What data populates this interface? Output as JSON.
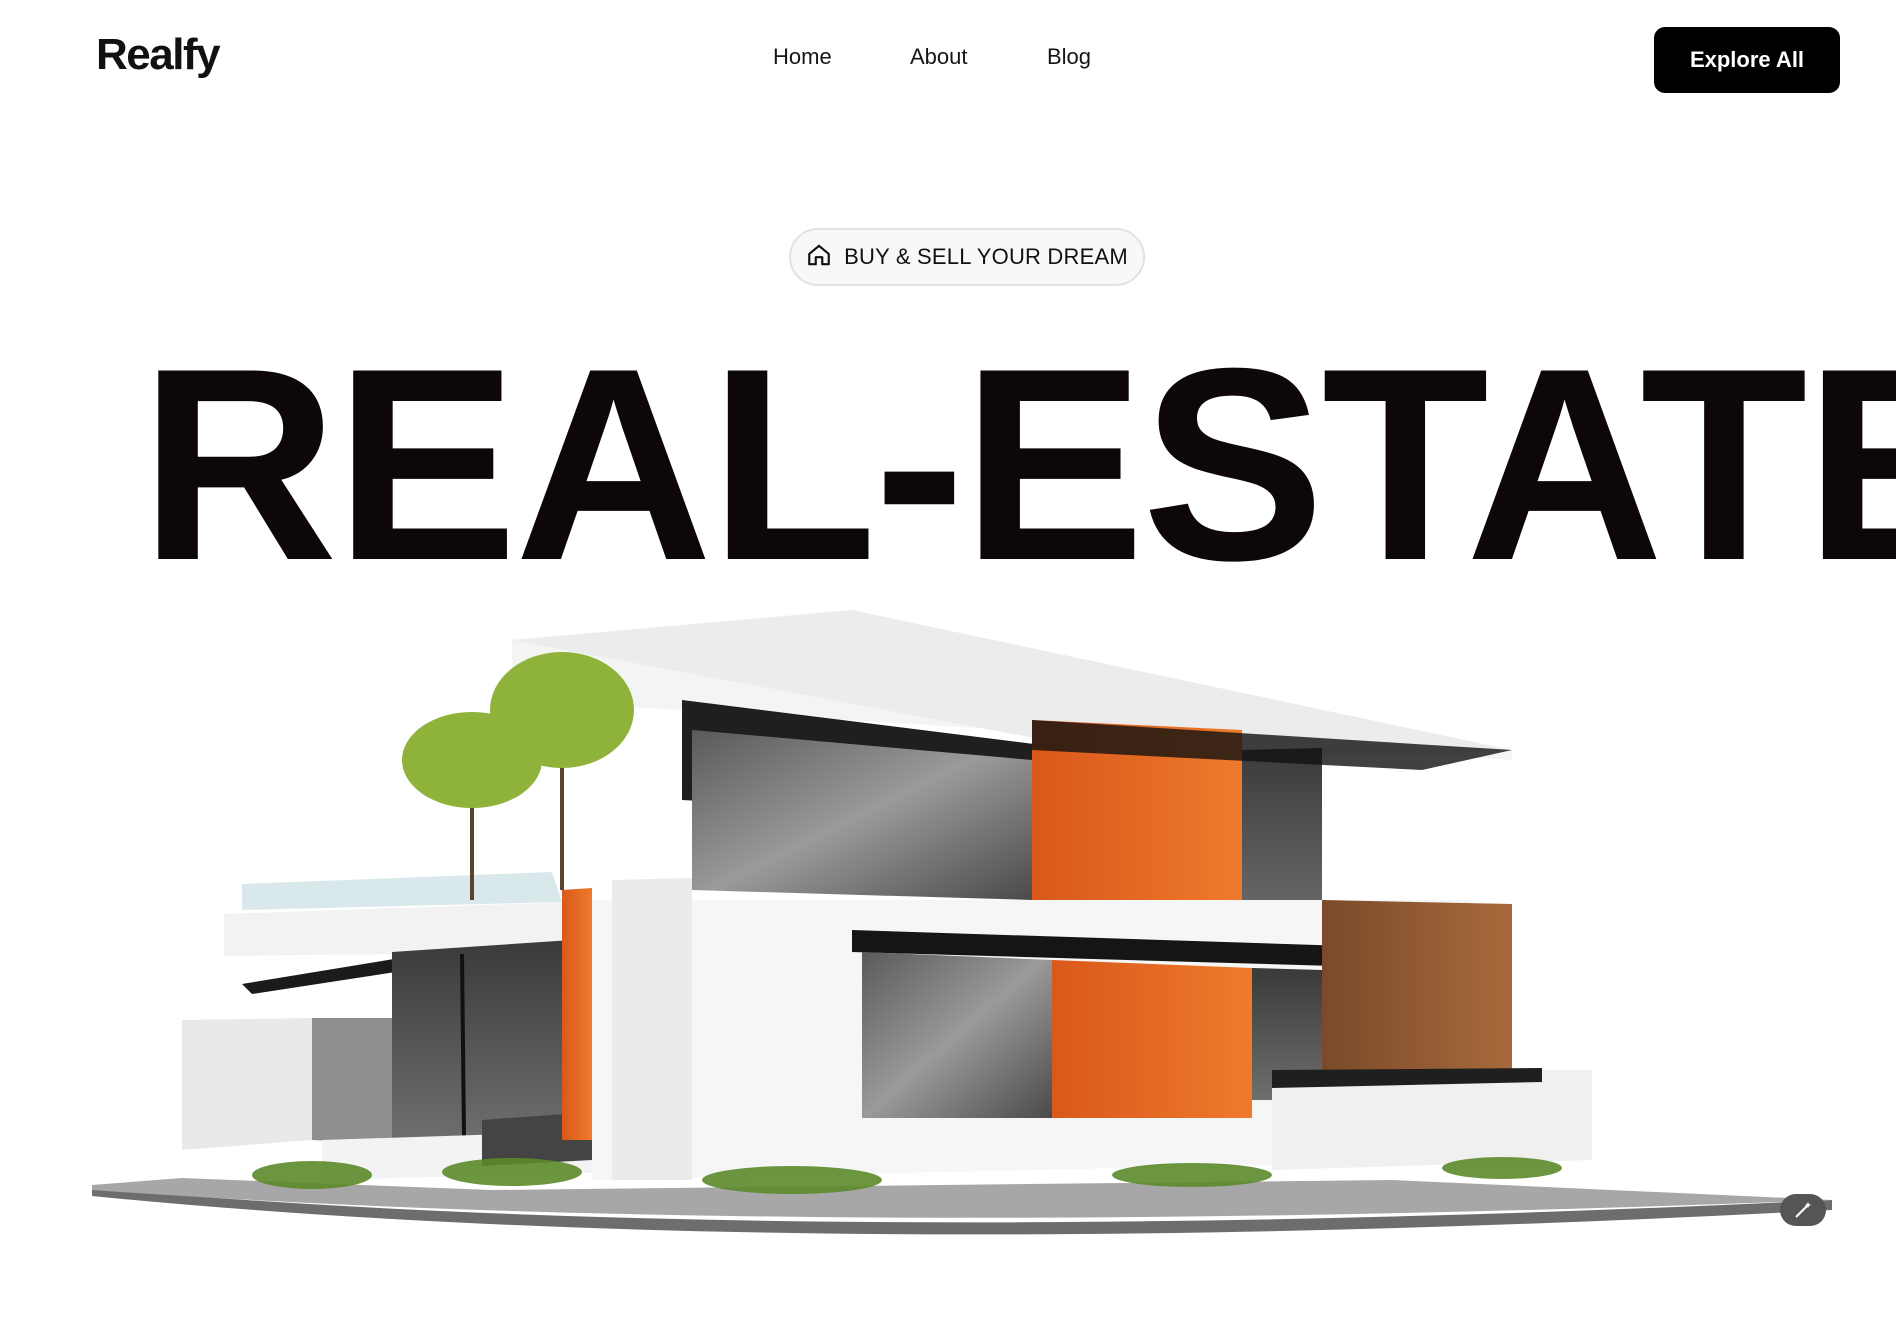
{
  "brand": {
    "logo": "Realfy"
  },
  "nav": {
    "items": [
      "Home",
      "About",
      "Blog"
    ]
  },
  "header": {
    "cta_label": "Explore All"
  },
  "hero": {
    "badge_icon": "home-outline-icon",
    "badge_text": "BUY & SELL YOUR DREAM",
    "title": "REAL-ESTATE"
  },
  "colors": {
    "text": "#0e0709",
    "cta_background": "#000000",
    "accent_orange": "#e4651f",
    "badge_background": "#f8f8f8"
  }
}
